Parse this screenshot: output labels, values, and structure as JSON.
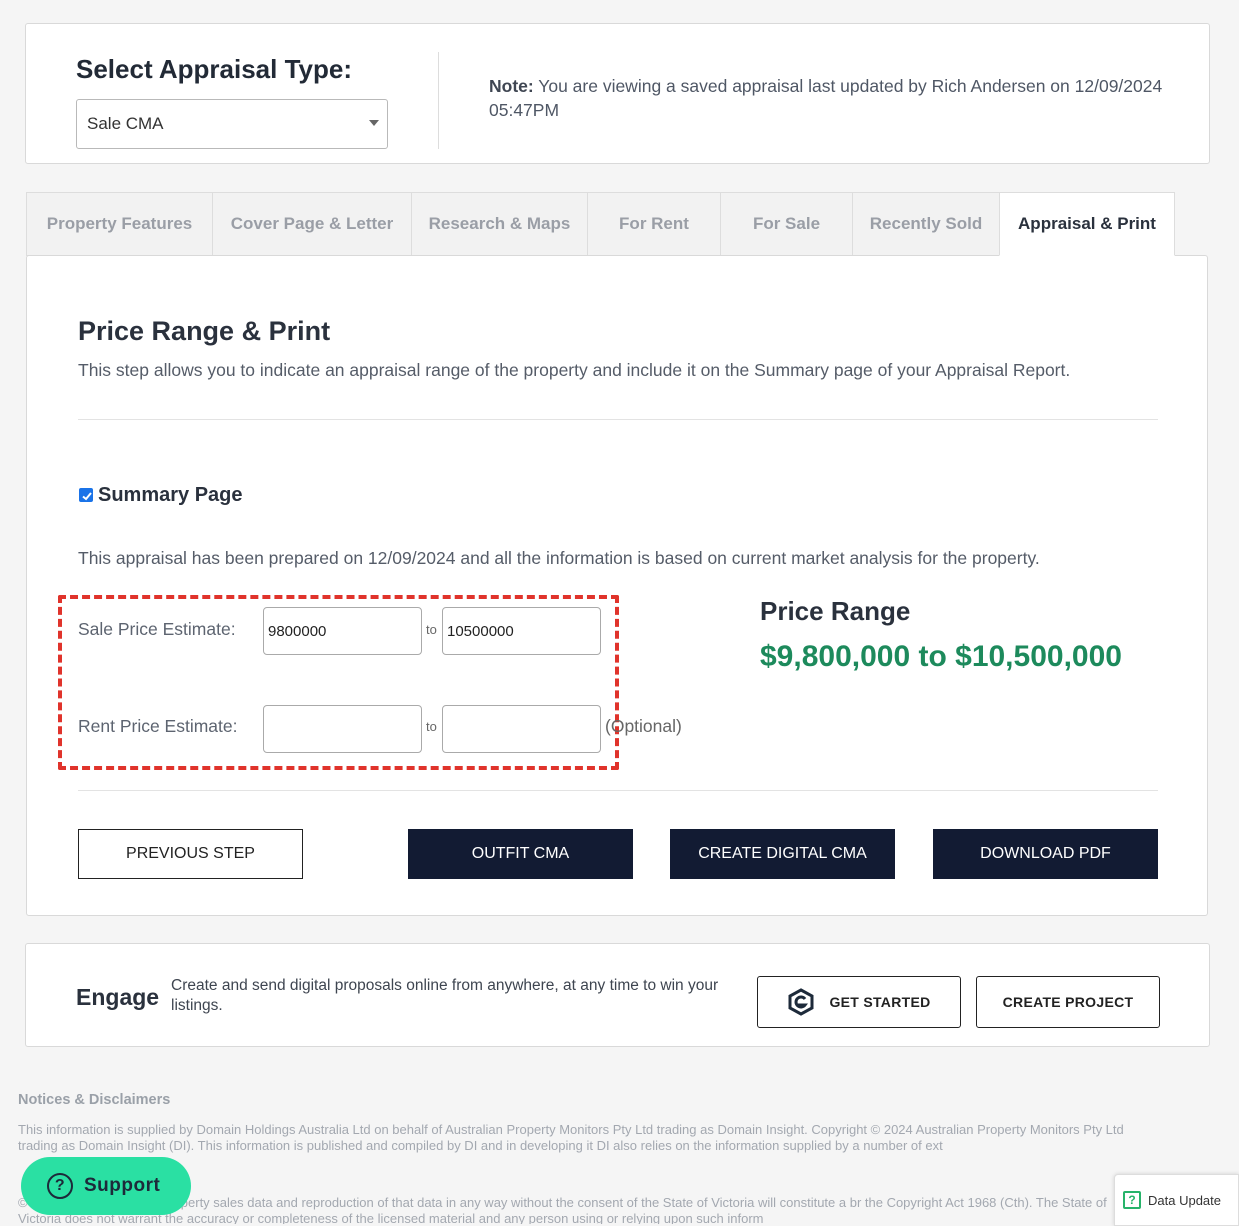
{
  "appraisal": {
    "title": "Select Appraisal Type:",
    "selected": "Sale CMA",
    "note_label": "Note:",
    "note_text": " You are viewing a saved appraisal last updated by Rich Andersen on 12/09/2024 05:47PM"
  },
  "tabs": [
    {
      "label": "Property Features"
    },
    {
      "label": "Cover Page & Letter"
    },
    {
      "label": "Research & Maps"
    },
    {
      "label": "For Rent"
    },
    {
      "label": "For Sale"
    },
    {
      "label": "Recently Sold"
    },
    {
      "label": "Appraisal & Print",
      "active": true
    }
  ],
  "main": {
    "title": "Price Range & Print",
    "description": "This step allows you to indicate an appraisal range of the property and include it on the Summary page of your Appraisal Report.",
    "summary_label": "Summary Page",
    "summary_checked": true,
    "prepared_text": "This appraisal has been prepared on 12/09/2024 and all the information is based on current market analysis for the property.",
    "sale_label": "Sale Price Estimate:",
    "sale_from": "9800000",
    "sale_to": "10500000",
    "rent_label": "Rent Price Estimate:",
    "rent_from": "",
    "rent_to": "",
    "to_text": "to",
    "optional_text": "(Optional)",
    "range_title": "Price Range",
    "range_value": "$9,800,000 to $10,500,000",
    "range_color": "#1d8a5c",
    "highlight_color": "#e0332b"
  },
  "buttons": {
    "previous": "PREVIOUS STEP",
    "outfit": "OUTFIT CMA",
    "digital": "CREATE DIGITAL CMA",
    "pdf": "DOWNLOAD PDF",
    "dark_color": "#121b33"
  },
  "engage": {
    "title": "Engage",
    "text": "Create and send digital proposals online from anywhere, at any time to win your listings.",
    "get_started": "GET STARTED",
    "create_project": "CREATE PROJECT"
  },
  "footer": {
    "notices_title": "Notices & Disclaimers",
    "disclaimer_1": "This information is supplied by Domain Holdings Australia Ltd on behalf of Australian Property Monitors Pty Ltd trading as Domain Insight. Copyright © 2024 Australian Property Monitors Pty Ltd trading as Domain Insight (DI). This information is published and compiled by DI and in developing it DI also relies on the information supplied by a number of ext",
    "disclaimer_2": "© ns the copyright in the property sales data and reproduction of that data in any way without the consent of the State of Victoria will constitute a br the Copyright Act 1968 (Cth). The State of Victoria does not warrant the accuracy or completeness of the licensed material and any person using or relying upon such inform",
    "support": "Support",
    "data_update": "Data Update",
    "support_color": "#2ae0a3"
  }
}
